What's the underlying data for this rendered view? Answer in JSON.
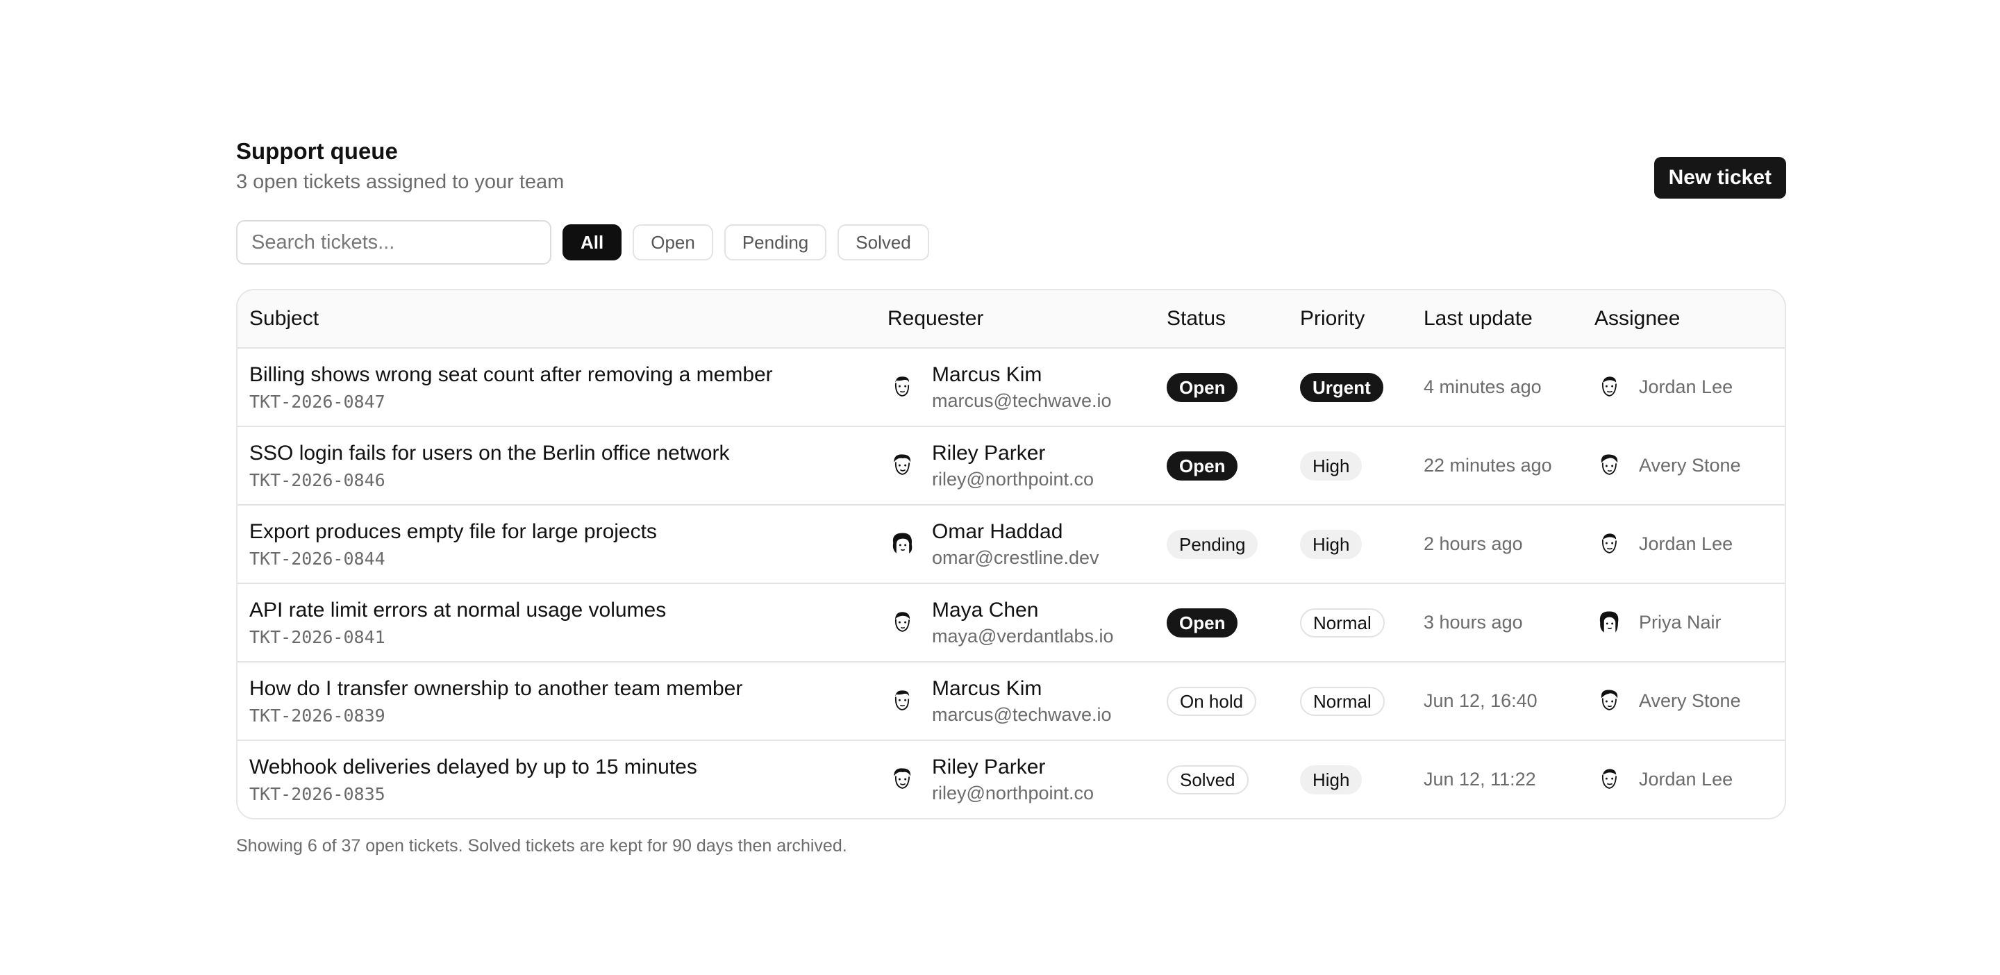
{
  "header": {
    "title": "Support queue",
    "subtitle": "3 open tickets assigned to your team",
    "new_ticket_label": "New ticket"
  },
  "search": {
    "placeholder": "Search tickets...",
    "value": ""
  },
  "filters": [
    {
      "label": "All",
      "active": true
    },
    {
      "label": "Open",
      "active": false
    },
    {
      "label": "Pending",
      "active": false
    },
    {
      "label": "Solved",
      "active": false
    }
  ],
  "table": {
    "columns": [
      "Subject",
      "Requester",
      "Status",
      "Priority",
      "Last update",
      "Assignee"
    ],
    "rows": [
      {
        "subject": "Billing shows wrong seat count after removing a member",
        "id": "TKT-2026-0847",
        "requester_name": "Marcus Kim",
        "requester_email": "marcus@techwave.io",
        "requester_avatar": "avatar-marcus-icon",
        "status": "Open",
        "status_style": "dark",
        "priority": "Urgent",
        "priority_style": "dark",
        "last_update": "4 minutes ago",
        "assignee": "Jordan Lee",
        "assignee_avatar": "avatar-jordan-icon"
      },
      {
        "subject": "SSO login fails for users on the Berlin office network",
        "id": "TKT-2026-0846",
        "requester_name": "Riley Parker",
        "requester_email": "riley@northpoint.co",
        "requester_avatar": "avatar-riley-icon",
        "status": "Open",
        "status_style": "dark",
        "priority": "High",
        "priority_style": "gray",
        "last_update": "22 minutes ago",
        "assignee": "Avery Stone",
        "assignee_avatar": "avatar-avery-icon"
      },
      {
        "subject": "Export produces empty file for large projects",
        "id": "TKT-2026-0844",
        "requester_name": "Omar Haddad",
        "requester_email": "omar@crestline.dev",
        "requester_avatar": "avatar-omar-icon",
        "status": "Pending",
        "status_style": "gray",
        "priority": "High",
        "priority_style": "gray",
        "last_update": "2 hours ago",
        "assignee": "Jordan Lee",
        "assignee_avatar": "avatar-jordan-icon"
      },
      {
        "subject": "API rate limit errors at normal usage volumes",
        "id": "TKT-2026-0841",
        "requester_name": "Maya Chen",
        "requester_email": "maya@verdantlabs.io",
        "requester_avatar": "avatar-maya-icon",
        "status": "Open",
        "status_style": "dark",
        "priority": "Normal",
        "priority_style": "outline",
        "last_update": "3 hours ago",
        "assignee": "Priya Nair",
        "assignee_avatar": "avatar-priya-icon"
      },
      {
        "subject": "How do I transfer ownership to another team member",
        "id": "TKT-2026-0839",
        "requester_name": "Marcus Kim",
        "requester_email": "marcus@techwave.io",
        "requester_avatar": "avatar-marcus-icon",
        "status": "On hold",
        "status_style": "outline",
        "priority": "Normal",
        "priority_style": "outline",
        "last_update": "Jun 12, 16:40",
        "assignee": "Avery Stone",
        "assignee_avatar": "avatar-avery-icon"
      },
      {
        "subject": "Webhook deliveries delayed by up to 15 minutes",
        "id": "TKT-2026-0835",
        "requester_name": "Riley Parker",
        "requester_email": "riley@northpoint.co",
        "requester_avatar": "avatar-riley-icon",
        "status": "Solved",
        "status_style": "outline",
        "priority": "High",
        "priority_style": "gray",
        "last_update": "Jun 12, 11:22",
        "assignee": "Jordan Lee",
        "assignee_avatar": "avatar-jordan-icon"
      }
    ]
  },
  "footer": {
    "note": "Showing 6 of 37 open tickets. Solved tickets are kept for 90 days then archived."
  },
  "colors": {
    "accent": "#161616",
    "muted_text": "#6b6b6b",
    "border": "#e3e3e3",
    "badge_gray": "#f0f0f0"
  }
}
